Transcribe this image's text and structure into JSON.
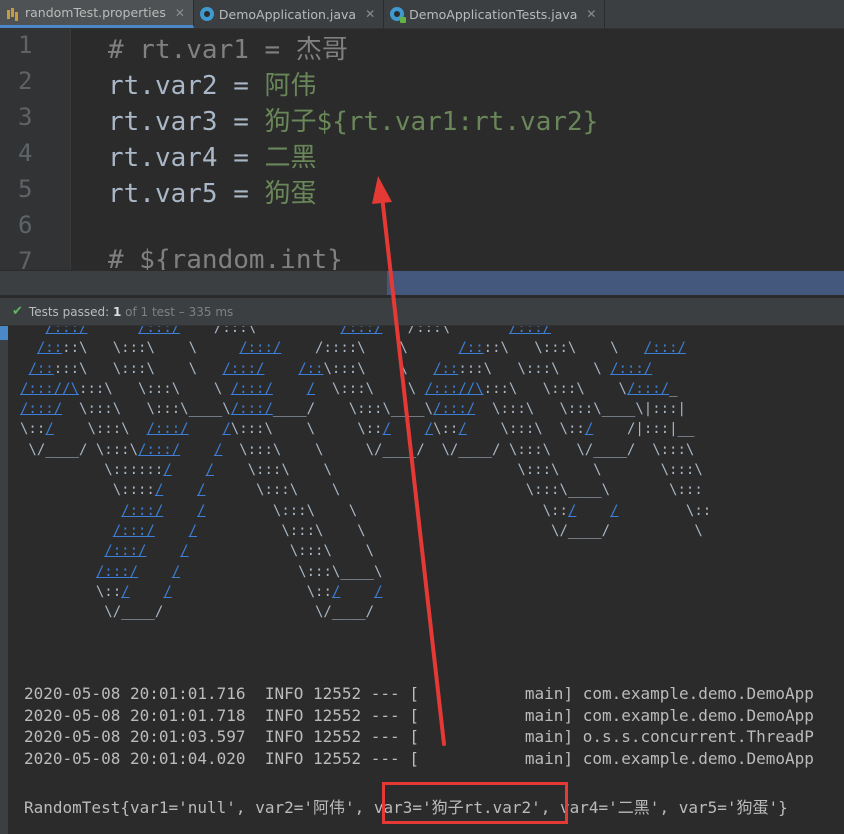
{
  "tabs": [
    {
      "label": "randomTest.properties",
      "icon": "properties-file-icon",
      "active": true
    },
    {
      "label": "DemoApplication.java",
      "icon": "java-class-icon",
      "active": false
    },
    {
      "label": "DemoApplicationTests.java",
      "icon": "java-test-class-icon",
      "active": false
    }
  ],
  "editor": {
    "lines": [
      {
        "num": "1",
        "comment": "# rt.var1 = 杰哥"
      },
      {
        "num": "2",
        "key": "rt.var2 = ",
        "value": "阿伟"
      },
      {
        "num": "3",
        "key": "rt.var3 = ",
        "value": "狗子${rt.var1:rt.var2}"
      },
      {
        "num": "4",
        "key": "rt.var4 = ",
        "value": "二黑"
      },
      {
        "num": "5",
        "key": "rt.var5 = ",
        "value": "狗蛋"
      },
      {
        "num": "6",
        "key": ""
      },
      {
        "num": "7",
        "comment": "# ${random.int}"
      }
    ]
  },
  "run": {
    "status": "Tests passed: ",
    "count": "1",
    "of": " of 1 test – 335 ms"
  },
  "console": {
    "log_lines": [
      "2020-05-08 20:01:01.716  INFO 12552 --- [           main] com.example.demo.DemoApp",
      "2020-05-08 20:01:01.718  INFO 12552 --- [           main] com.example.demo.DemoApp",
      "2020-05-08 20:01:03.597  INFO 12552 --- [           main] o.s.s.concurrent.ThreadP",
      "2020-05-08 20:01:04.020  INFO 12552 --- [           main] com.example.demo.DemoApp"
    ],
    "result": "RandomTest{var1='null', var2='阿伟', var3='狗子rt.var2', var4='二黑', var5='狗蛋'}"
  },
  "colors": {
    "annotation": "#e53935",
    "accent": "#4a88c7",
    "string": "#6a8759",
    "comment": "#808080"
  }
}
